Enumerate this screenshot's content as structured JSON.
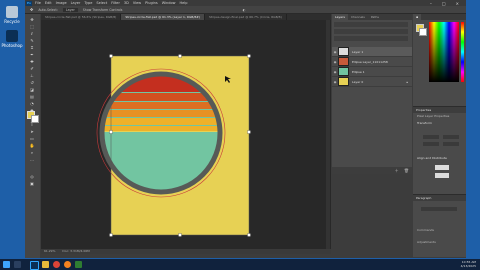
{
  "desktop": {
    "icons": [
      {
        "label": "Recycle",
        "icon": "recycle-bin-icon"
      },
      {
        "label": "Photoshop",
        "icon": "photoshop-icon"
      }
    ]
  },
  "app": {
    "logo": "Ps",
    "menu": [
      "File",
      "Edit",
      "Image",
      "Layer",
      "Type",
      "Select",
      "Filter",
      "3D",
      "View",
      "Plugins",
      "Window",
      "Help"
    ],
    "options": [
      "Auto-Select:",
      "Layer",
      "Show Transform Controls"
    ],
    "tabs": [
      {
        "label": "Stripes-circle-flat.psd @ 56.6% (Stripes, RGB/8)",
        "active": false
      },
      {
        "label": "Stripes-circle-flat.psd @ 61.3% (Layer 1, RGB/8#)",
        "active": true
      },
      {
        "label": "Stripes-design-final.psd @ 66.7% (Circle, RGB/8)",
        "active": false
      }
    ],
    "status": {
      "zoom": "61.29%",
      "doc": "Doc: 3.31M/4.06M"
    }
  },
  "layers_panel": {
    "tabs": [
      "Layers",
      "Channels",
      "Paths"
    ],
    "layers": [
      {
        "name": "Layer 1",
        "selected": true
      },
      {
        "name": "Ellipse Layer_11011258",
        "selected": false
      },
      {
        "name": "Ellipse 1",
        "selected": false
      },
      {
        "name": "Layer 0",
        "selected": false
      }
    ]
  },
  "properties": {
    "title": "Properties",
    "subtitle": "Pixel Layer Properties",
    "section": "Transform",
    "align": "Align and Distribute"
  },
  "paths_panel": {
    "title": "Paragraph",
    "item": "Commands",
    "footer": "Adjustments"
  },
  "design": {
    "background": "#e7d154",
    "circle_bg": "#72c5a1",
    "ring": "#575a57",
    "stripes": [
      "#c42f1f",
      "#d2501f",
      "#dd6f22",
      "#e79124",
      "#eeb12a"
    ]
  },
  "taskbar": {
    "time": "10:55 AM",
    "date": "4/13/2025"
  }
}
